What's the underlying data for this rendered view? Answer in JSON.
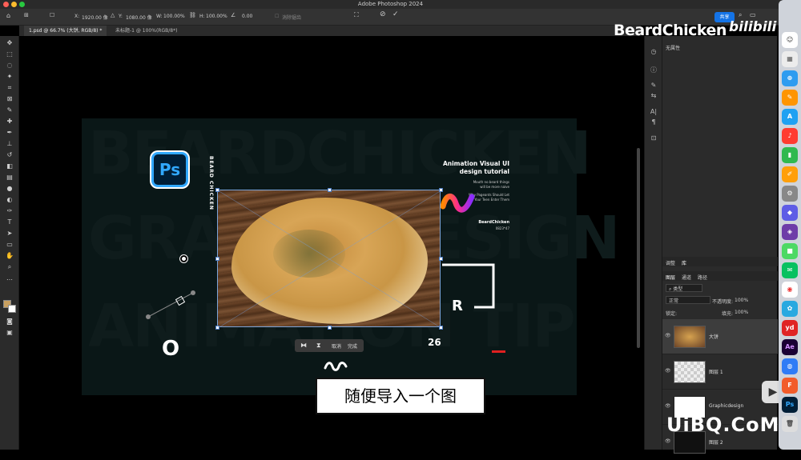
{
  "menubar": {
    "app_title": "Adobe Photoshop 2024"
  },
  "options": {
    "x_label": "X:",
    "x_value": "1920.00 像",
    "y_label": "Y:",
    "y_value": "1080.00 像",
    "w_label": "W:",
    "w_value": "100.00%",
    "h_label": "H:",
    "h_value": "100.00%",
    "angle_value": "0.00",
    "aa_label": "消除锯齿",
    "share_label": "共享"
  },
  "tabs": [
    {
      "label": "1.psd @ 66.7% (大饼, RGB/8) *"
    },
    {
      "label": "未标题-1 @ 100%(RGB/8*)"
    }
  ],
  "watermarks": {
    "top": "BeardChicken",
    "bilibili": "bilibili",
    "bottom": "UiBQ.CoM"
  },
  "design": {
    "bg_lines": [
      "BEARDCHICKEN",
      "GRAPHICDESIGN",
      "ANIMATION TIP"
    ],
    "ps_logo": "Ps",
    "vertical_text": "BEARD CHICKEN",
    "headline": "Animation Visual UI design tutorial",
    "small_text_1": "Mouth no beard things will be more naive",
    "small_text_2": "Why Pageants Should Let Your Teen Enter Them",
    "brand": "BeardChicken",
    "brand_sub": "0823*47",
    "letter_o": "O",
    "letter_r": "R",
    "number_26": "26"
  },
  "transform_bar": {
    "cancel": "取消",
    "done": "完成"
  },
  "subtitle": "随便导入一个图",
  "properties": {
    "title": "无属性"
  },
  "panel_tabs": [
    "调整",
    "库"
  ],
  "layer_tabs": [
    "图层",
    "通道",
    "路径"
  ],
  "layer_filter": "类型",
  "blend_mode": "正常",
  "opacity_label": "不透明度:",
  "opacity_value": "100%",
  "fill_label": "填充:",
  "fill_value": "100%",
  "lock_label": "锁定:",
  "layers": [
    {
      "name": "大饼"
    },
    {
      "name": "图层 1"
    },
    {
      "name": "Graphicdesign"
    },
    {
      "name": "图层 2"
    }
  ],
  "dock_apps": [
    "Ps",
    "Ae",
    "yd",
    "F"
  ],
  "colors": {
    "accent": "#1473e6",
    "teal": "#0f1c1c",
    "ps_blue": "#31a8ff"
  }
}
